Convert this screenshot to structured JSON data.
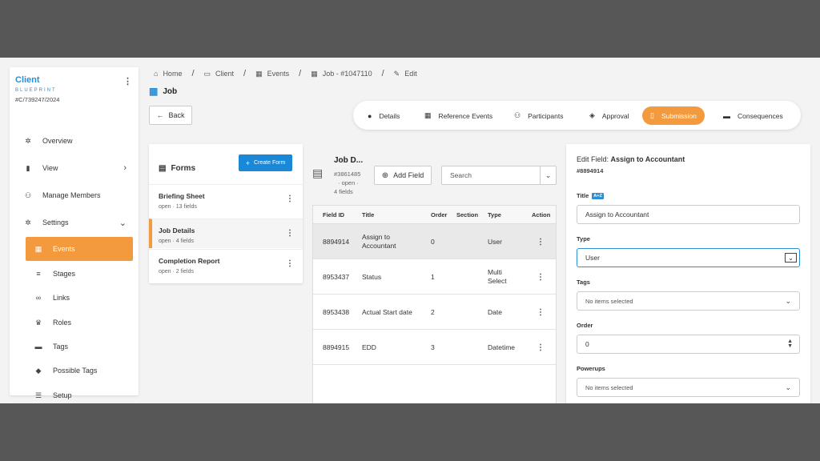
{
  "sidebar": {
    "title": "Client",
    "subtitle": "BLUEPRINT",
    "id": "#C/739247/2024",
    "items": [
      {
        "label": "Overview",
        "icon": "gear-icon"
      },
      {
        "label": "View",
        "icon": "file-icon"
      },
      {
        "label": "Manage Members",
        "icon": "users-icon"
      },
      {
        "label": "Settings",
        "icon": "gear-icon"
      },
      {
        "label": "Events",
        "icon": "calendar-icon"
      },
      {
        "label": "Stages",
        "icon": "bars-icon"
      },
      {
        "label": "Links",
        "icon": "link-icon"
      },
      {
        "label": "Roles",
        "icon": "crown-icon"
      },
      {
        "label": "Tags",
        "icon": "folder-icon"
      },
      {
        "label": "Possible Tags",
        "icon": "tags-icon"
      },
      {
        "label": "Setup",
        "icon": "list-icon"
      }
    ]
  },
  "breadcrumb": [
    "Home",
    "Client",
    "Events",
    "Job - #1047110",
    "Edit"
  ],
  "page_title": "Job",
  "back_label": "Back",
  "tabs": [
    "Details",
    "Reference Events",
    "Participants",
    "Approval",
    "Submission",
    "Consequences"
  ],
  "active_tab": "Submission",
  "forms": {
    "heading": "Forms",
    "create_label": "Create Form",
    "items": [
      {
        "title": "Briefing Sheet",
        "meta": "open · 13 fields"
      },
      {
        "title": "Job Details",
        "meta": "open · 4 fields"
      },
      {
        "title": "Completion Report",
        "meta": "open · 2 fields"
      }
    ]
  },
  "job": {
    "title": "Job D...",
    "id": "#3861485",
    "status": "· open ·",
    "fields": "4 fields",
    "add_field_label": "Add Field",
    "search_placeholder": "Search"
  },
  "table": {
    "headers": [
      "Field ID",
      "Title",
      "Order",
      "Section",
      "Type",
      "Action"
    ],
    "rows": [
      {
        "id": "8894914",
        "title": "Assign to Accountant",
        "order": "0",
        "section": "",
        "type": "User"
      },
      {
        "id": "8953437",
        "title": "Status",
        "order": "1",
        "section": "",
        "type": "Multi Select"
      },
      {
        "id": "8953438",
        "title": "Actual Start date",
        "order": "2",
        "section": "",
        "type": "Date"
      },
      {
        "id": "8894915",
        "title": "EDD",
        "order": "3",
        "section": "",
        "type": "Datetime"
      }
    ]
  },
  "edit": {
    "heading_prefix": "Edit Field:",
    "heading_name": "Assign to Accountant",
    "id": "#8894914",
    "title_label": "Title",
    "title_badge": "A+Z",
    "title_value": "Assign to Accountant",
    "type_label": "Type",
    "type_value": "User",
    "tags_label": "Tags",
    "tags_value": "No items selected",
    "order_label": "Order",
    "order_value": "0",
    "powerups_label": "Powerups",
    "powerups_value": "No items selected"
  },
  "colors": {
    "accent": "#f39a3f",
    "primary": "#1a88d6",
    "link": "#2b8fd6"
  }
}
